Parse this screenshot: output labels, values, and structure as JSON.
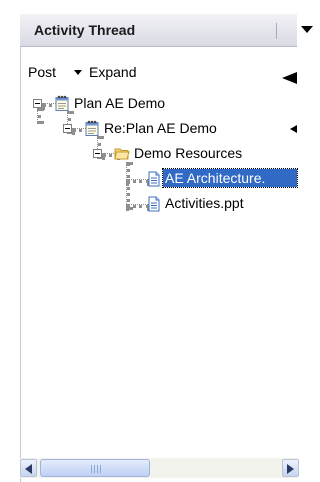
{
  "panel": {
    "title": "Activity Thread"
  },
  "toolbar": {
    "post_label": "Post",
    "expand_label": "Expand"
  },
  "tree": {
    "root": {
      "label": "Plan AE Demo",
      "icon": "notepad-icon"
    },
    "reply": {
      "label": "Re:Plan AE Demo",
      "icon": "notepad-icon"
    },
    "folder": {
      "label": "Demo Resources",
      "icon": "folder-open-icon"
    },
    "files": [
      {
        "label": "AE Architecture.",
        "icon": "document-icon",
        "selected": true
      },
      {
        "label": "Activities.ppt",
        "icon": "document-icon",
        "selected": false
      }
    ]
  },
  "scrollbar": {
    "grip_text": "III"
  },
  "colors": {
    "selection": "#316ac5",
    "header_gradient_top": "#f2f2f6",
    "header_gradient_bottom": "#d9dae4"
  }
}
